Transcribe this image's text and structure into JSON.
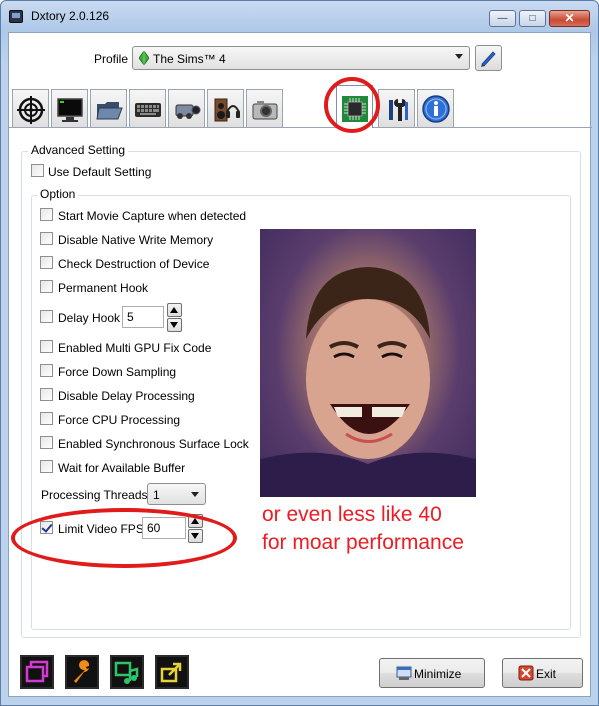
{
  "window": {
    "title": "Dxtory 2.0.126",
    "icon": "dxtory-app-icon",
    "caption_buttons": {
      "minimize": "—",
      "maximize": "□",
      "close": "✕"
    }
  },
  "profile": {
    "label": "Profile",
    "value": "The Sims™ 4",
    "game_icon": "sims-plumbob-icon",
    "edit_icon": "pencil-icon"
  },
  "tabs": [
    {
      "icon": "crosshair-target-icon"
    },
    {
      "icon": "monitor-icon"
    },
    {
      "icon": "folder-icon"
    },
    {
      "icon": "keyboard-icon"
    },
    {
      "icon": "video-camera-icon"
    },
    {
      "icon": "speaker-headphones-icon"
    },
    {
      "icon": "photo-camera-icon"
    },
    {
      "icon": "chip-processor-icon",
      "active": true
    },
    {
      "icon": "tools-icon"
    },
    {
      "icon": "info-icon"
    }
  ],
  "advanced": {
    "title": "Advanced Setting",
    "use_default_label": "Use Default Setting",
    "use_default_checked": false
  },
  "option": {
    "title": "Option",
    "items": [
      {
        "label": "Start Movie Capture when detected",
        "checked": false
      },
      {
        "label": "Disable Native Write Memory",
        "checked": false
      },
      {
        "label": "Check Destruction of Device",
        "checked": false
      },
      {
        "label": "Permanent Hook",
        "checked": false
      },
      {
        "label": "Delay Hook",
        "checked": false
      },
      {
        "label": "Enabled Multi GPU Fix Code",
        "checked": false
      },
      {
        "label": "Force Down Sampling",
        "checked": false
      },
      {
        "label": "Disable Delay Processing",
        "checked": false
      },
      {
        "label": "Force CPU Processing",
        "checked": false
      },
      {
        "label": "Enabled Synchronous Surface Lock",
        "checked": false
      },
      {
        "label": "Wait for Available Buffer",
        "checked": false
      }
    ],
    "delay_hook_value": "5",
    "processing_threads_label": "Processing Threads",
    "processing_threads_value": "1",
    "limit_fps_label": "Limit Video FPS",
    "limit_fps_checked": true,
    "limit_fps_value": "60"
  },
  "annotation": {
    "line1": "or even less like 40",
    "line2": "for moar performance",
    "color": "#ec1c24"
  },
  "bottom": {
    "icons": [
      "overlay-windows-icon",
      "wrench-icon",
      "video-audio-icon",
      "export-icon"
    ],
    "minimize_label": "Minimize",
    "exit_label": "Exit"
  }
}
